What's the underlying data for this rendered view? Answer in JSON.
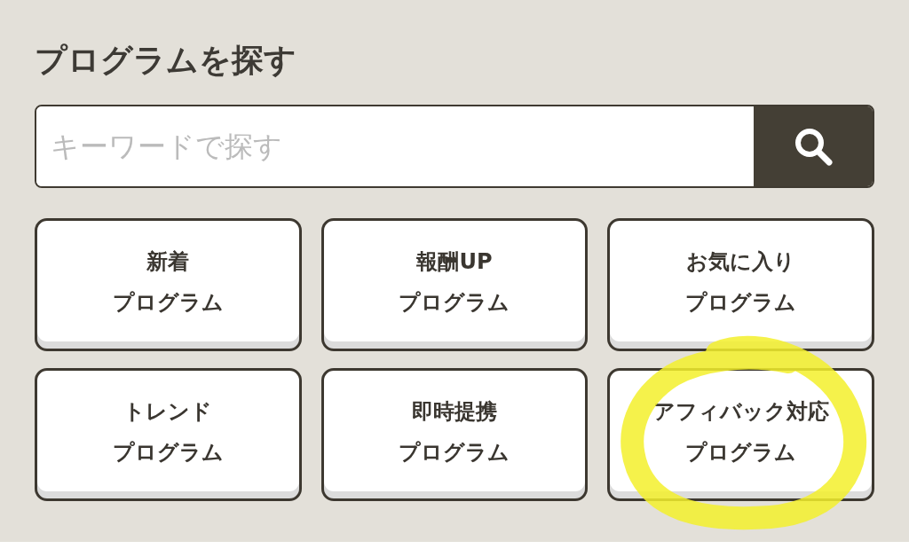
{
  "title": "プログラムを探す",
  "search": {
    "placeholder": "キーワードで探す"
  },
  "buttons": [
    {
      "lines": [
        "新着",
        "プログラム"
      ]
    },
    {
      "lines": [
        "報酬UP",
        "プログラム"
      ]
    },
    {
      "lines": [
        "お気に入り",
        "プログラム"
      ]
    },
    {
      "lines": [
        "トレンド",
        "プログラム"
      ]
    },
    {
      "lines": [
        "即時提携",
        "プログラム"
      ]
    },
    {
      "lines": [
        "アフィバック対応",
        "プログラム"
      ]
    }
  ]
}
